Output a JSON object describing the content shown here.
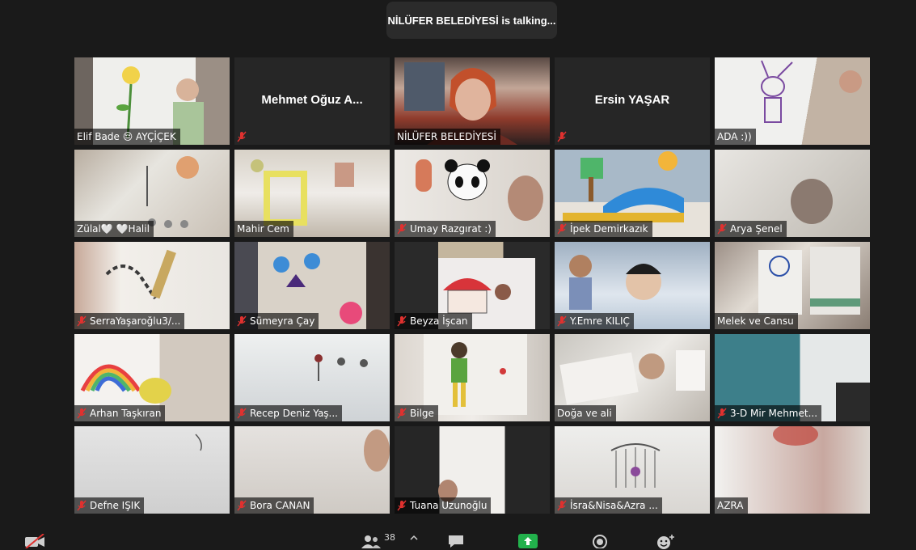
{
  "talking_banner": "NİLÜFER BELEDİYESİ is talking...",
  "colors": {
    "active_border": "#c8e06a",
    "muted_mic": "#e0312f",
    "share": "#22b14c"
  },
  "participants": [
    {
      "name": "Elif Bade 😔 AYÇİÇEK",
      "muted": false,
      "video": true
    },
    {
      "name": "Mehmet Oğuz A...",
      "muted": true,
      "video": false
    },
    {
      "name": "NİLÜFER BELEDİYESİ",
      "muted": false,
      "video": true,
      "active": true
    },
    {
      "name": "Ersin YAŞAR",
      "muted": true,
      "video": false
    },
    {
      "name": "ADA :))",
      "muted": false,
      "video": true
    },
    {
      "name": "Zülal🤍 🤍Halil",
      "muted": false,
      "video": true
    },
    {
      "name": "Mahir Cem",
      "muted": false,
      "video": true
    },
    {
      "name": "Umay Razgırat :)",
      "muted": true,
      "video": true
    },
    {
      "name": "İpek Demirkazık",
      "muted": true,
      "video": true
    },
    {
      "name": "Arya Şenel",
      "muted": true,
      "video": true
    },
    {
      "name": "SerraYaşaroğlu3/...",
      "muted": true,
      "video": true
    },
    {
      "name": "Sümeyra Çay",
      "muted": true,
      "video": true
    },
    {
      "name": "Beyza İşcan",
      "muted": true,
      "video": true
    },
    {
      "name": "Y.Emre KILIÇ",
      "muted": true,
      "video": true
    },
    {
      "name": "Melek ve Cansu",
      "muted": false,
      "video": true
    },
    {
      "name": "Arhan Taşkıran",
      "muted": true,
      "video": true
    },
    {
      "name": "Recep Deniz Yaş...",
      "muted": true,
      "video": true
    },
    {
      "name": "Bilge",
      "muted": true,
      "video": true
    },
    {
      "name": "Doğa ve ali",
      "muted": false,
      "video": true
    },
    {
      "name": "3-D Mir Mehmet...",
      "muted": true,
      "video": true
    },
    {
      "name": "Defne IŞIK",
      "muted": true,
      "video": true
    },
    {
      "name": "Bora CANAN",
      "muted": true,
      "video": true
    },
    {
      "name": "Tuana Uzunoğlu",
      "muted": true,
      "video": true
    },
    {
      "name": "İsra&Nisa&Azra ...",
      "muted": true,
      "video": true
    },
    {
      "name": "AZRA",
      "muted": false,
      "video": true
    }
  ],
  "toolbar": {
    "participants_count": "38",
    "icons": [
      "video-off-icon",
      "participants-icon",
      "chevron-up-icon",
      "chat-icon",
      "share-screen-icon",
      "record-icon",
      "reactions-icon"
    ]
  }
}
